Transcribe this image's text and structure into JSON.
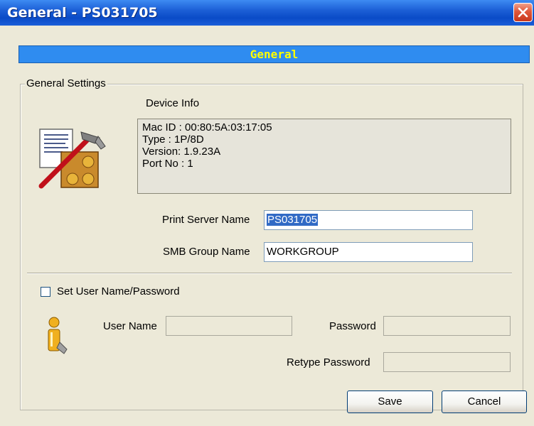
{
  "window": {
    "title": "General - PS031705"
  },
  "header": {
    "label": "General"
  },
  "group": {
    "legend": "General Settings"
  },
  "device_info": {
    "label": "Device Info",
    "lines": [
      "Mac ID : 00:80:5A:03:17:05",
      "Type : 1P/8D",
      "Version: 1.9.23A",
      "Port No : 1"
    ]
  },
  "print_server": {
    "label": "Print Server Name",
    "value": "PS031705"
  },
  "smb_group": {
    "label": "SMB Group Name",
    "value": "WORKGROUP"
  },
  "auth": {
    "checkbox_label": "Set User Name/Password",
    "user_name_label": "User Name",
    "user_name_value": "",
    "password_label": "Password",
    "password_value": "",
    "retype_label": "Retype Password",
    "retype_value": ""
  },
  "buttons": {
    "save": "Save",
    "cancel": "Cancel"
  },
  "icons": {
    "title_close": "close-icon",
    "device": "tools-document-icon",
    "user": "user-icon"
  },
  "colors": {
    "title_bar": "#0a4bc7",
    "header_band": "#2f8cf0",
    "header_text": "#ffff00",
    "dialog_bg": "#ece9d8"
  }
}
